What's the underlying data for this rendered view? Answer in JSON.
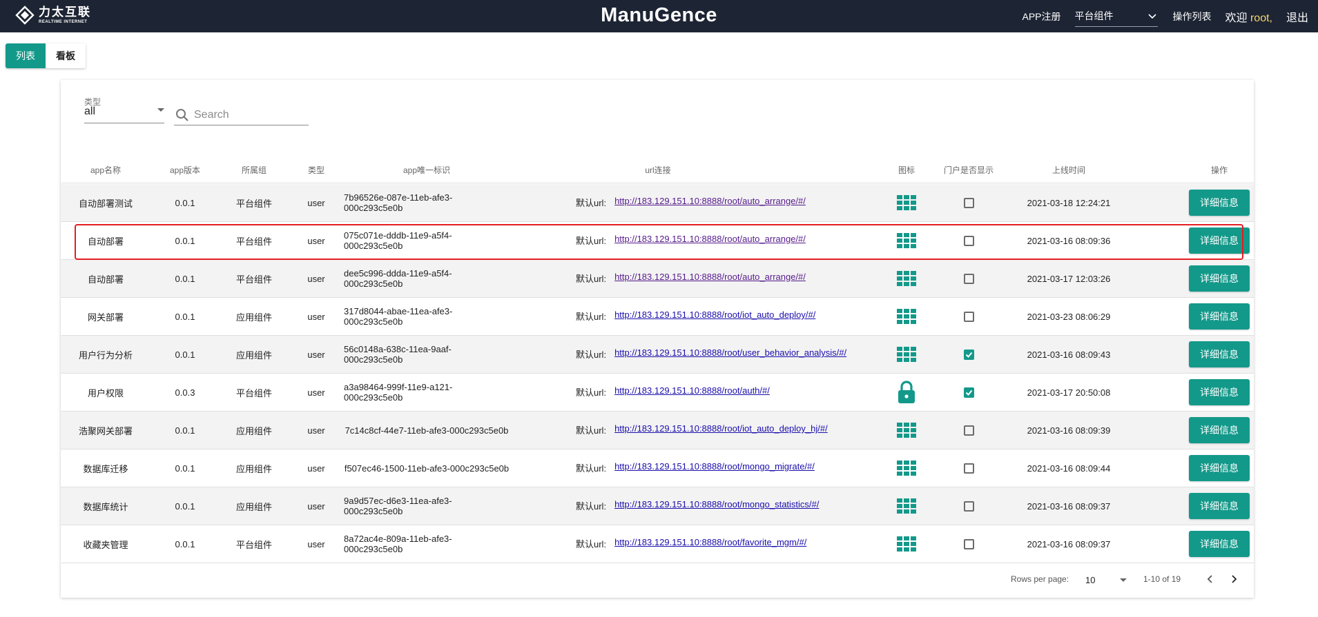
{
  "header": {
    "logo_cn": "力太互联",
    "logo_en": "REALTIME INTERNET",
    "brand": "ManuGence",
    "app_register": "APP注册",
    "group_select": "平台组件",
    "ops_list": "操作列表",
    "welcome_prefix": "欢迎",
    "username": "root,",
    "logout": "退出"
  },
  "view_toggle": {
    "list": "列表",
    "board": "看板"
  },
  "filters": {
    "type_label": "类型",
    "type_value": "all",
    "search_placeholder": "Search"
  },
  "table": {
    "columns": [
      "app名称",
      "app版本",
      "所属组",
      "类型",
      "app唯一标识",
      "url连接",
      "图标",
      "门户是否显示",
      "上线时间",
      "操作"
    ],
    "url_label": "默认url:",
    "detail_label": "详细信息",
    "rows": [
      {
        "name": "自动部署测试",
        "version": "0.0.1",
        "group": "平台组件",
        "type": "user",
        "uid": "7b96526e-087e-11eb-afe3-000c293c5e0b",
        "url": "http://183.129.151.10:8888/root/auto_arrange/#/",
        "icon": "grid-icon",
        "portal": false,
        "online": "2021-03-18 12:24:21"
      },
      {
        "name": "自动部署",
        "version": "0.0.1",
        "group": "平台组件",
        "type": "user",
        "uid": "075c071e-dddb-11e9-a5f4-000c293c5e0b",
        "url": "http://183.129.151.10:8888/root/auto_arrange/#/",
        "icon": "grid-icon",
        "portal": false,
        "online": "2021-03-16 08:09:36"
      },
      {
        "name": "自动部署",
        "version": "0.0.1",
        "group": "平台组件",
        "type": "user",
        "uid": "dee5c996-ddda-11e9-a5f4-000c293c5e0b",
        "url": "http://183.129.151.10:8888/root/auto_arrange/#/",
        "icon": "grid-icon",
        "portal": false,
        "online": "2021-03-17 12:03:26"
      },
      {
        "name": "网关部署",
        "version": "0.0.1",
        "group": "应用组件",
        "type": "user",
        "uid": "317d8044-abae-11ea-afe3-000c293c5e0b",
        "url": "http://183.129.151.10:8888/root/iot_auto_deploy/#/",
        "icon": "grid-icon",
        "portal": false,
        "online": "2021-03-23 08:06:29"
      },
      {
        "name": "用户行为分析",
        "version": "0.0.1",
        "group": "应用组件",
        "type": "user",
        "uid": "56c0148a-638c-11ea-9aaf-000c293c5e0b",
        "url": "http://183.129.151.10:8888/root/user_behavior_analysis/#/",
        "icon": "grid-icon",
        "portal": true,
        "online": "2021-03-16 08:09:43"
      },
      {
        "name": "用户权限",
        "version": "0.0.3",
        "group": "平台组件",
        "type": "user",
        "uid": "a3a98464-999f-11e9-a121-000c293c5e0b",
        "url": "http://183.129.151.10:8888/root/auth/#/",
        "icon": "lock-icon",
        "portal": true,
        "online": "2021-03-17 20:50:08"
      },
      {
        "name": "浩聚网关部署",
        "version": "0.0.1",
        "group": "应用组件",
        "type": "user",
        "uid": "7c14c8cf-44e7-11eb-afe3-000c293c5e0b",
        "url": "http://183.129.151.10:8888/root/iot_auto_deploy_hj/#/",
        "icon": "grid-icon",
        "portal": false,
        "online": "2021-03-16 08:09:39"
      },
      {
        "name": "数据库迁移",
        "version": "0.0.1",
        "group": "应用组件",
        "type": "user",
        "uid": "f507ec46-1500-11eb-afe3-000c293c5e0b",
        "url": "http://183.129.151.10:8888/root/mongo_migrate/#/",
        "icon": "grid-icon",
        "portal": false,
        "online": "2021-03-16 08:09:44"
      },
      {
        "name": "数据库统计",
        "version": "0.0.1",
        "group": "应用组件",
        "type": "user",
        "uid": "9a9d57ec-d6e3-11ea-afe3-000c293c5e0b",
        "url": "http://183.129.151.10:8888/root/mongo_statistics/#/",
        "icon": "grid-icon",
        "portal": false,
        "online": "2021-03-16 08:09:37"
      },
      {
        "name": "收藏夹管理",
        "version": "0.0.1",
        "group": "平台组件",
        "type": "user",
        "uid": "8a72ac4e-809a-11eb-afe3-000c293c5e0b",
        "url": "http://183.129.151.10:8888/root/favorite_mgm/#/",
        "icon": "grid-icon",
        "portal": false,
        "online": "2021-03-16 08:09:37"
      }
    ]
  },
  "pagination": {
    "rows_per_page_label": "Rows per page:",
    "rows_per_page": "10",
    "range": "1-10 of 19"
  },
  "colors": {
    "accent": "#13998a",
    "header_bg": "#1d2433",
    "highlight": "#e51c23",
    "username": "#f5d76e"
  }
}
